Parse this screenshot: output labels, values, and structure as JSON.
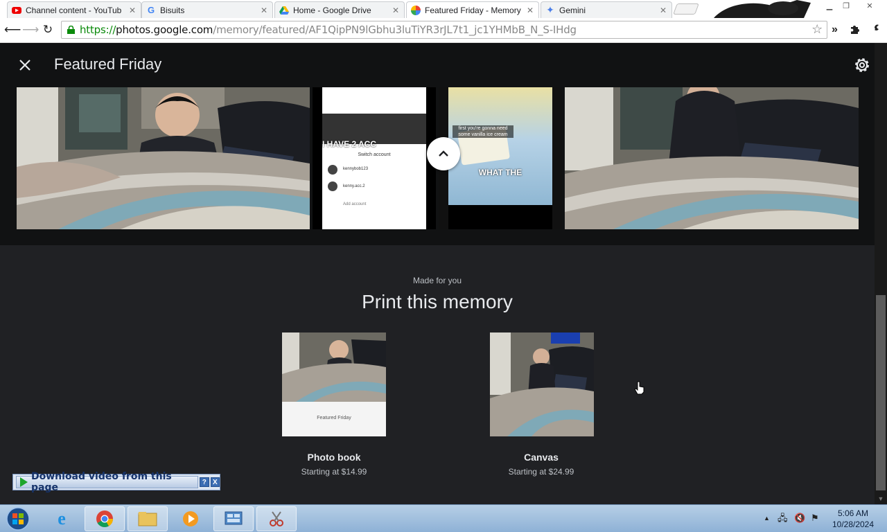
{
  "browser": {
    "tabs": [
      {
        "title": "Channel content - YouTub",
        "icon": "youtube-icon"
      },
      {
        "title": "Bisuits",
        "icon": "google-icon"
      },
      {
        "title": "Home - Google Drive",
        "icon": "drive-icon"
      },
      {
        "title": "Featured Friday - Memory",
        "icon": "photos-icon",
        "active": true
      },
      {
        "title": "Gemini",
        "icon": "gemini-icon"
      }
    ],
    "url_scheme": "https://",
    "url_host": "photos.google.com",
    "url_path": "/memory/featured/AF1QipPN9lGbhu3luTiYR3rJL7t1_jc1YHMbB_N_S-IHdg"
  },
  "memory": {
    "title": "Featured Friday",
    "close_icon": "close-icon",
    "settings_icon": "gear-icon",
    "scroll_up_icon": "chevron-up-icon",
    "screenshot1": {
      "caption": "I HAVE 2 ACC",
      "sheet_title": "Switch account",
      "accounts": [
        "kennybob123",
        "kenny.acc.2"
      ],
      "add_account": "Add account"
    },
    "screenshot2": {
      "caption_top": "first you're gonna need some vanilla ice cream",
      "caption_mid": "WHAT THE"
    }
  },
  "print": {
    "eyebrow": "Made for you",
    "title": "Print this memory",
    "products": [
      {
        "name": "Photo book",
        "price": "Starting at $14.99",
        "cover_text": "Featured Friday"
      },
      {
        "name": "Canvas",
        "price": "Starting at $24.99"
      }
    ]
  },
  "download_bar": {
    "label": "Download video from this page",
    "help": "?",
    "close": "X"
  },
  "taskbar": {
    "time": "5:06 AM",
    "date": "10/28/2024"
  }
}
